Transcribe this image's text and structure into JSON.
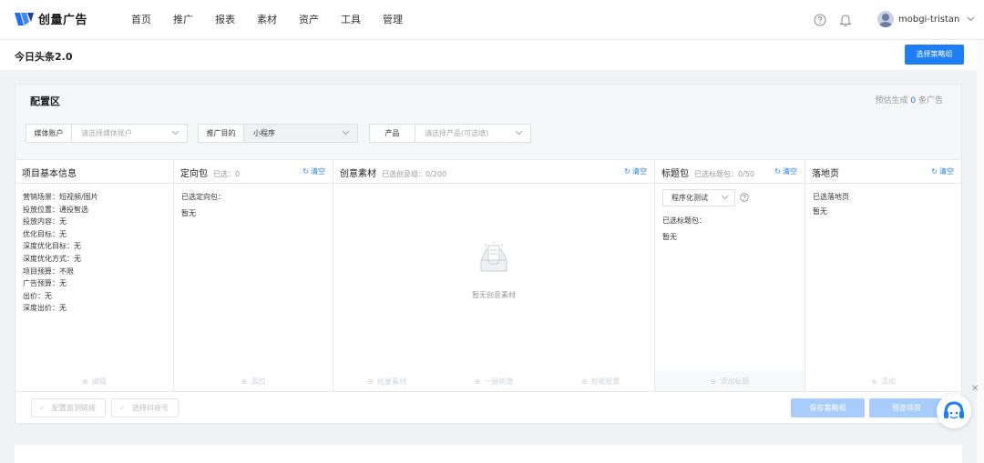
{
  "header": {
    "logo_text": "创量广告",
    "nav": [
      "首页",
      "推广",
      "报表",
      "素材",
      "资产",
      "工具",
      "管理"
    ],
    "username": "mobgi-tristan"
  },
  "subbar": {
    "title": "今日头条2.0",
    "primary_button": "选择策略组"
  },
  "config": {
    "title": "配置区",
    "estimate_prefix": "预估生成",
    "estimate_count": "0",
    "estimate_suffix": "条广告",
    "filters": [
      {
        "label": "媒体账户",
        "value": "请选择媒体账户",
        "filled": false
      },
      {
        "label": "推广目的",
        "value": "小程序",
        "filled": true
      },
      {
        "label": "产品",
        "value": "请选择产品(可选填)",
        "filled": false
      }
    ]
  },
  "columns": {
    "project": {
      "title": "项目基本信息",
      "lines": [
        "营销场景：短视频/图片",
        "投放位置：通投智选",
        "投放内容：无",
        "优化目标：无",
        "深度优化目标：无",
        "深度优化方式：无",
        "项目预算：不限",
        "广告预算：无",
        "出价：无",
        "深度出价：无"
      ],
      "footer": [
        "编辑"
      ]
    },
    "targeting": {
      "title": "定向包",
      "count": "已选：0",
      "clear": "清空",
      "selected_label": "已选定向包：",
      "empty": "暂无",
      "footer": [
        "添加"
      ]
    },
    "creative": {
      "title": "创意素材",
      "count": "已选创意组：0/200",
      "clear": "清空",
      "empty": "暂无创意素材",
      "footer": [
        "批量素材",
        "一键新增",
        "智能配置"
      ]
    },
    "headline": {
      "title": "标题包",
      "count": "已选标题包：0/50",
      "clear": "清空",
      "select_value": "程序化测试",
      "selected_label": "已选标题包：",
      "empty": "暂无",
      "footer": [
        "添加标题"
      ]
    },
    "landing": {
      "title": "落地页",
      "clear": "清空",
      "selected_label": "已选落地页",
      "empty": "暂无",
      "footer": [
        "添加"
      ]
    }
  },
  "footer_buttons": {
    "monitor": "配置监测链接",
    "material": "选择抖音号",
    "save": "保存策略组",
    "preview": "预览项目"
  },
  "colors": {
    "accent": "#1e7ef7",
    "disabled": "#a8cdfc"
  }
}
